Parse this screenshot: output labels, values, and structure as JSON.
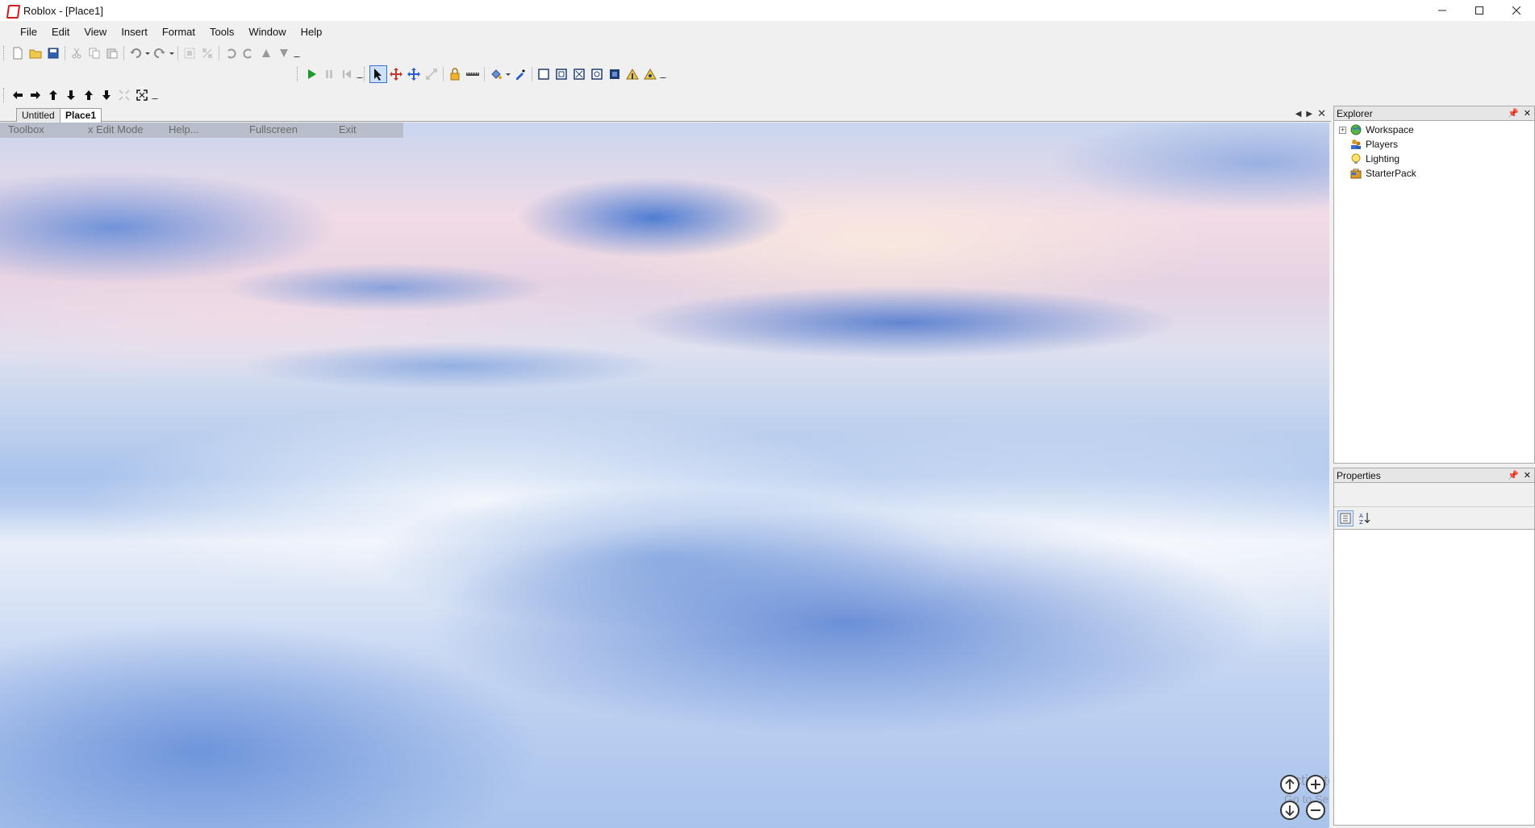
{
  "window": {
    "title": "Roblox - [Place1]",
    "controls": [
      "minimize-icon",
      "maximize-icon",
      "close-icon"
    ]
  },
  "menu": {
    "items": [
      "File",
      "Edit",
      "View",
      "Insert",
      "Format",
      "Tools",
      "Window",
      "Help"
    ]
  },
  "document_tabs": {
    "tabs": [
      {
        "label": "Untitled",
        "active": false
      },
      {
        "label": "Place1",
        "active": true
      }
    ]
  },
  "viewport_menu": {
    "toolbox": "Toolbox",
    "edit_mode": "x Edit Mode",
    "help": "Help...",
    "fullscreen": "Fullscreen",
    "exit": "Exit"
  },
  "watermark": {
    "line1": "Activate Windows",
    "line2": "Go to Settings to activate Windows."
  },
  "explorer": {
    "title": "Explorer",
    "items": [
      {
        "label": "Workspace",
        "icon": "globe-icon",
        "expandable": true
      },
      {
        "label": "Players",
        "icon": "players-icon",
        "expandable": false
      },
      {
        "label": "Lighting",
        "icon": "lightbulb-icon",
        "expandable": false
      },
      {
        "label": "StarterPack",
        "icon": "backpack-icon",
        "expandable": false
      }
    ]
  },
  "properties": {
    "title": "Properties"
  },
  "colors": {
    "accent_blue": "#3a6fd6",
    "play_green": "#1e9a2e",
    "panel_header": "#e6e6e6"
  }
}
